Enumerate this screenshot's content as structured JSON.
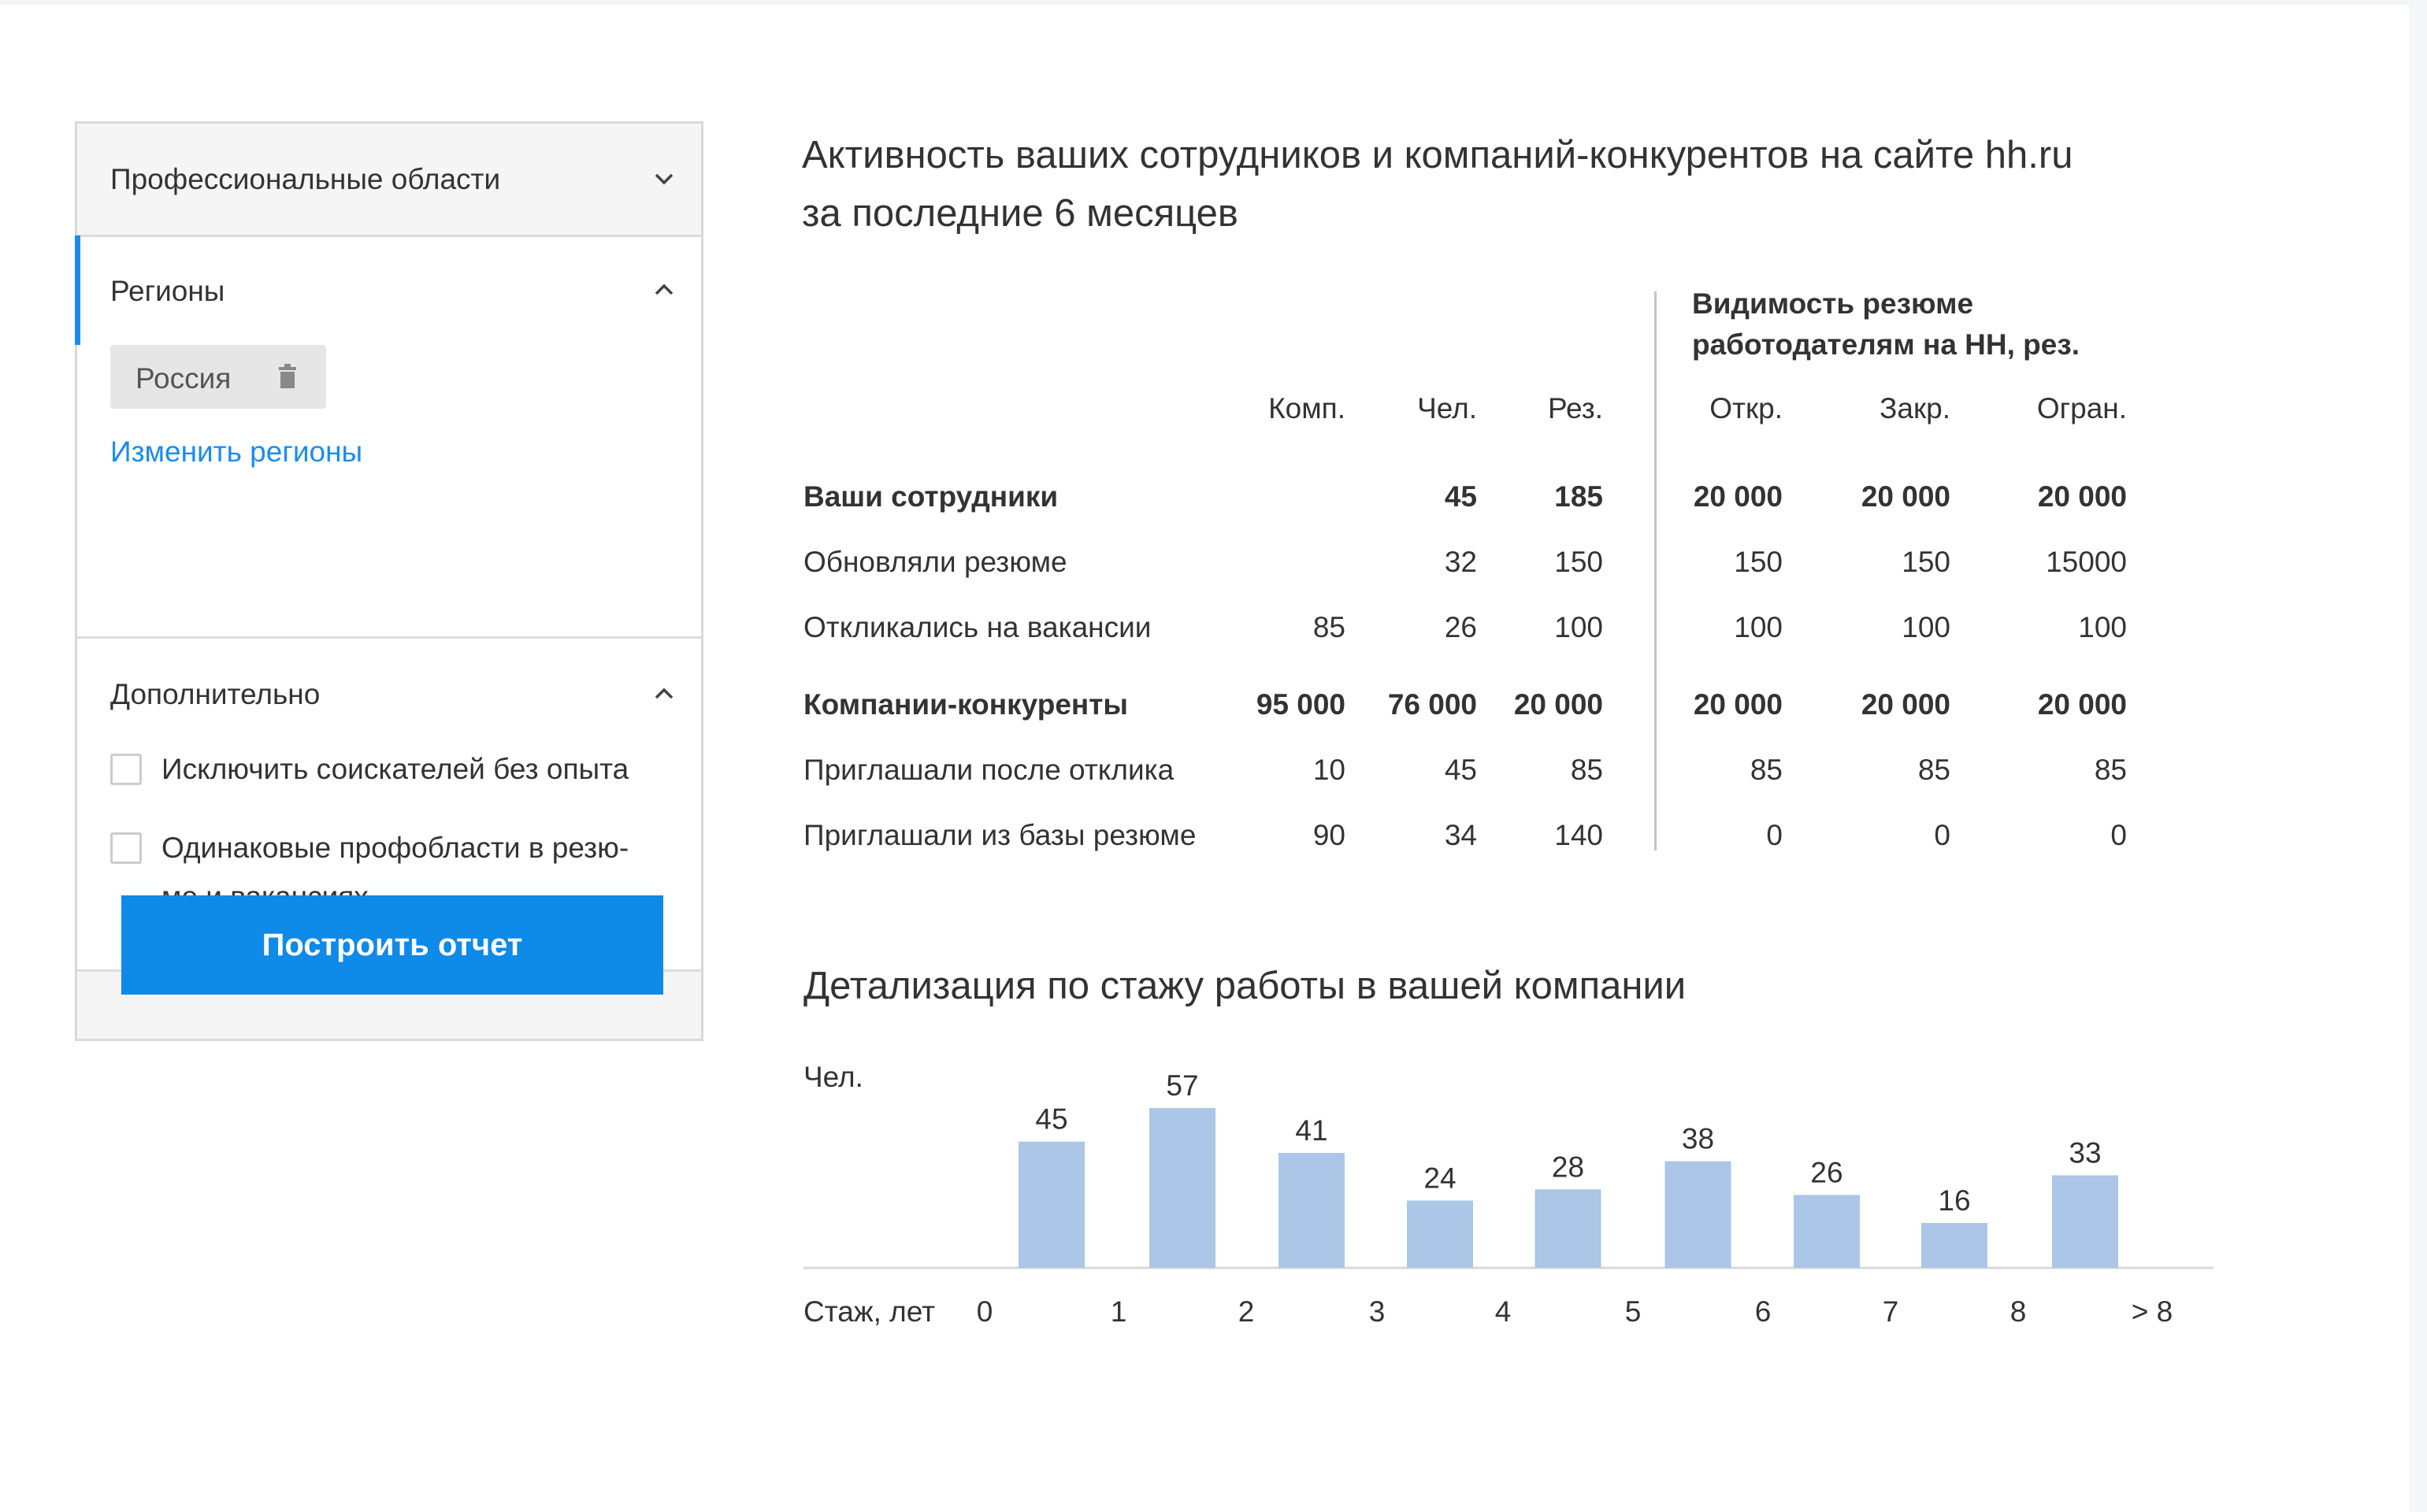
{
  "sidebar": {
    "prof_areas_title": "Профессиональные области",
    "regions_title": "Регионы",
    "region_chip": "Россия",
    "change_regions": "Изменить регионы",
    "additional_title": "Дополнительно",
    "checkbox_1": "Исключить соискателей без опыта",
    "checkbox_2_line1": "Одинаковые профобласти в резю-",
    "checkbox_2_line2": "ме и вакансиях",
    "build_button": "Построить отчет",
    "accent_color": "#1a8cf0"
  },
  "report": {
    "title_line1": "Активность ваших сотрудников и компаний-конкурентов на сайте hh.ru",
    "title_line2": "за последние 6 месяцев",
    "visibility_header_line1": "Видимость резюме",
    "visibility_header_line2": "работодателям на НН, рез.",
    "columns": [
      "Комп.",
      "Чел.",
      "Рез.",
      "Откр.",
      "Закр.",
      "Огран."
    ],
    "rows": [
      {
        "label": "Ваши сотрудники",
        "bold": true,
        "cells": [
          "",
          "45",
          "185",
          "20 000",
          "20 000",
          "20 000"
        ]
      },
      {
        "label": "Обновляли резюме",
        "bold": false,
        "cells": [
          "",
          "32",
          "150",
          "150",
          "150",
          "15000"
        ]
      },
      {
        "label": "Откликались на вакансии",
        "bold": false,
        "cells": [
          "85",
          "26",
          "100",
          "100",
          "100",
          "100"
        ]
      },
      {
        "label": "Компании-конкуренты",
        "bold": true,
        "cells": [
          "95 000",
          "76 000",
          "20 000",
          "20 000",
          "20 000",
          "20 000"
        ]
      },
      {
        "label": "Приглашали после отклика",
        "bold": false,
        "cells": [
          "10",
          "45",
          "85",
          "85",
          "85",
          "85"
        ]
      },
      {
        "label": "Приглашали из базы резюме",
        "bold": false,
        "cells": [
          "90",
          "34",
          "140",
          "0",
          "0",
          "0"
        ]
      }
    ],
    "detail_title": "Детализация по стажу работы в вашей компании"
  },
  "chart_data": {
    "type": "bar",
    "ylabel": "Чел.",
    "xlabel": "Стаж, лет",
    "x_ticks": [
      "0",
      "1",
      "2",
      "3",
      "4",
      "5",
      "6",
      "7",
      "8",
      "> 8"
    ],
    "values": [
      45,
      57,
      41,
      24,
      28,
      38,
      26,
      16,
      33
    ],
    "bar_color": "#abc6e6",
    "ylim": [
      0,
      57
    ],
    "grid": false
  }
}
